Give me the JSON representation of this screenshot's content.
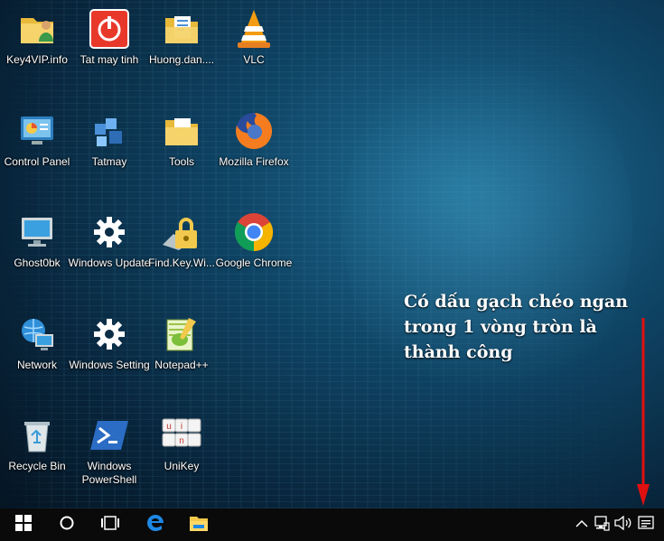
{
  "desktop": {
    "icons": [
      {
        "label": "Key4VIP.info",
        "icon": "user-folder-icon"
      },
      {
        "label": "Tat may tinh",
        "icon": "shutdown-icon"
      },
      {
        "label": "Huong.dan....",
        "icon": "document-folder-icon"
      },
      {
        "label": "VLC",
        "icon": "vlc-icon"
      },
      {
        "label": "Control Panel",
        "icon": "control-panel-icon"
      },
      {
        "label": "Tatmay",
        "icon": "cubes-icon"
      },
      {
        "label": "Tools",
        "icon": "tools-folder-icon"
      },
      {
        "label": "Mozilla Firefox",
        "icon": "firefox-icon"
      },
      {
        "label": "Ghost0bk",
        "icon": "computer-icon"
      },
      {
        "label": "Windows Update",
        "icon": "gear-icon"
      },
      {
        "label": "Find.Key.Wi...",
        "icon": "lock-icon"
      },
      {
        "label": "Google Chrome",
        "icon": "chrome-icon"
      },
      {
        "label": "Network",
        "icon": "network-icon"
      },
      {
        "label": "Windows Setting",
        "icon": "gear-icon"
      },
      {
        "label": "Notepad++",
        "icon": "notepad-icon"
      },
      {
        "label": "Recycle Bin",
        "icon": "recycle-bin-icon"
      },
      {
        "label": "Windows PowerShell",
        "icon": "powershell-icon"
      },
      {
        "label": "UniKey",
        "icon": "unikey-icon"
      }
    ]
  },
  "annotation": {
    "line1": "Có dấu gạch chéo ngan",
    "line2": "trong 1 vòng tròn là",
    "line3": "thành công",
    "color": "#ffffff",
    "arrow_color": "#e01010"
  },
  "taskbar": {
    "buttons": [
      "windows-start-icon",
      "cortana-search-icon",
      "task-view-icon",
      "edge-icon",
      "file-explorer-icon"
    ],
    "tray": [
      "chevron-up-icon",
      "network-icon",
      "volume-icon",
      "action-center-icon"
    ],
    "background": "#0a0a0a"
  },
  "accent": {
    "shutdown": "#e8382a",
    "vlc": "#f39c12",
    "folder": "#f2c94c"
  }
}
